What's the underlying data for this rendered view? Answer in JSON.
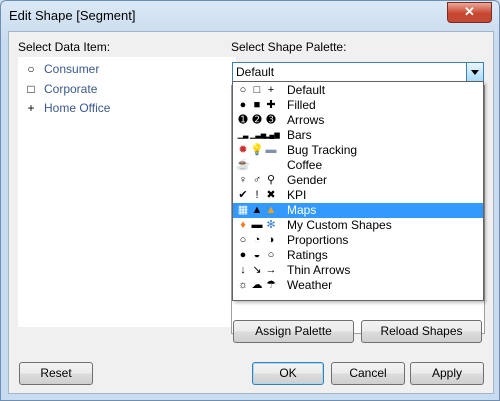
{
  "window": {
    "title": "Edit Shape [Segment]",
    "close_glyph": "✕"
  },
  "left": {
    "label": "Select Data Item:",
    "items": [
      {
        "glyph": "○",
        "label": "Consumer",
        "icon": "circle-icon"
      },
      {
        "glyph": "□",
        "label": "Corporate",
        "icon": "square-icon"
      },
      {
        "glyph": "+",
        "label": "Home Office",
        "icon": "plus-icon"
      }
    ]
  },
  "right": {
    "label": "Select Shape Palette:",
    "combo_value": "Default",
    "options": [
      {
        "label": "Default",
        "icons": [
          "○",
          "□",
          "+"
        ]
      },
      {
        "label": "Filled",
        "icons": [
          "●",
          "■",
          "✚"
        ]
      },
      {
        "label": "Arrows",
        "icons": [
          "➊",
          "➋",
          "➌"
        ]
      },
      {
        "label": "Bars",
        "icons": [
          "▁▃",
          "▁▃▅",
          "▂▄▆"
        ]
      },
      {
        "label": "Bug Tracking",
        "icons": [
          "✹",
          "💡",
          "▬"
        ]
      },
      {
        "label": "Coffee",
        "icons": [
          "☕",
          "",
          ""
        ]
      },
      {
        "label": "Gender",
        "icons": [
          "♀",
          "♂",
          "⚲"
        ]
      },
      {
        "label": "KPI",
        "icons": [
          "✔",
          "!",
          "✖"
        ]
      },
      {
        "label": "Maps",
        "icons": [
          "▦",
          "▲",
          "▲"
        ]
      },
      {
        "label": "My Custom Shapes",
        "icons": [
          "♦",
          "▬",
          "✻"
        ]
      },
      {
        "label": "Proportions",
        "icons": [
          "○",
          "◔",
          "◑"
        ]
      },
      {
        "label": "Ratings",
        "icons": [
          "●",
          "◒",
          "○"
        ]
      },
      {
        "label": "Thin Arrows",
        "icons": [
          "↓",
          "↘",
          "→"
        ]
      },
      {
        "label": "Weather",
        "icons": [
          "☼",
          "☁",
          "☂"
        ]
      }
    ],
    "selected_option": "Maps",
    "selected_color": "#3399ff"
  },
  "buttons": {
    "assign_palette": "Assign Palette",
    "reload_shapes": "Reload Shapes",
    "reset": "Reset",
    "ok": "OK",
    "cancel": "Cancel",
    "apply": "Apply"
  }
}
